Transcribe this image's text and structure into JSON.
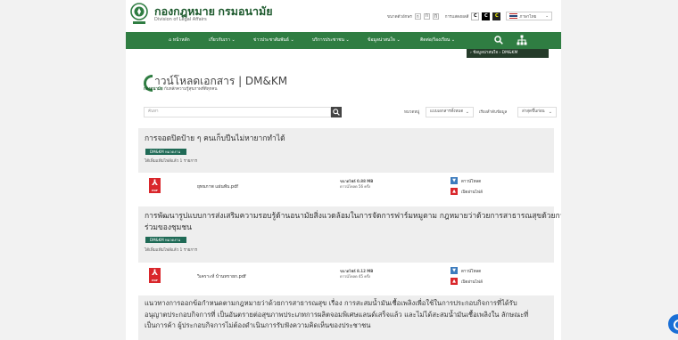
{
  "header": {
    "title": "กองกฎหมาย กรมอนามัย",
    "subtitle": "Division of Legal Affairs",
    "font_label": "ขนาดตัวอักษร",
    "font_sizes": [
      "ก",
      "ก",
      "ก"
    ],
    "contrast_label": "การแสดงผลสี",
    "contrast_opts": [
      "C",
      "C",
      "C"
    ],
    "language": "ภาษาไทย"
  },
  "nav": {
    "home": "หน้าหลัก",
    "about": "เกี่ยวกับเรา",
    "news": "ข่าวประชาสัมพันธ์",
    "services": "บริการประชาชน",
    "info": "ข้อมูลน่าสนใจ",
    "contact": "ติดต่อ/ร้องเรียน"
  },
  "breadcrumb": {
    "text": "›  ข้อมูลน่าสนใจ   ›  DM&KM"
  },
  "page": {
    "title": "าวน์โหลดเอกสาร | DM&KM",
    "sub_bold": "กองอนามัย",
    "sub_rest": "กับหลักความรู้สุขภาพที่ดีทุกคน"
  },
  "search": {
    "placeholder": "ค้นหา",
    "category_label": "หมวดหมู่",
    "category_value": "แบบเอกสารทั้งหมด",
    "sort_label": "เรียงลำดับข้อมูล",
    "sort_value": "ล่าสุดขึ้นก่อน"
  },
  "colors": {
    "green": "#2f7d42",
    "tag": "#1f6a56",
    "pdf": "#d9262b"
  },
  "cards": [
    {
      "title_lines": [
        "การจอดปิดป้าย ๆ คนเก็บปีนไม่หายากทำได้"
      ],
      "tag": "DM&KM หมวดงาน",
      "count": "ได้เพิ่มแฟ้มไฟล์แล้ว 1 รายการ",
      "file": {
        "name": "ยุทธภาพ แผ่นพับ.pdf",
        "size": "ขนาดไฟล์ 0.88 MB",
        "downloads": "ดาวน์โหลด 56 ครั้ง",
        "download_label": "ดาวน์โหลด",
        "preview_label": "เปิดอ่านไฟล์"
      }
    },
    {
      "title_lines": [
        "การพัฒนารูปแบบการส่งเสริมความรอบรู้ด้านอนามัยสิ่งแวดล้อมในการจัดการฟาร์มหมูตาม กฎหมายว่าด้วยการสาธารณสุขด้วยการมีส่วน",
        "ร่วมของชุมชน"
      ],
      "tag": "DM&KM หมวดงาน",
      "count": "ได้เพิ่มแฟ้มไฟล์แล้ว 1 รายการ",
      "file": {
        "name": "วิเคราะห์ บ้านทรายก.pdf",
        "size": "ขนาดไฟล์ 8.12 MB",
        "downloads": "ดาวน์โหลด 45 ครั้ง",
        "download_label": "ดาวน์โหลด",
        "preview_label": "เปิดอ่านไฟล์"
      }
    },
    {
      "title_lines": [
        "แนวทางการออกข้อกำหนดตามกฎหมายว่าด้วยการสาธารณสุข เรื่อง การสะสมน้ำมันเชื้อเพลิงเพื่อใช้ในการประกอบกิจการที่ได้รับ",
        "อนุญาตประกอบกิจการที่ เป็นอันตรายต่อสุขภาพประเภทการผลิตจอมพิเศษแลนด์เสร็จแล้ว และไม่ได้สะสมน้ำมันเชื้อเพลิงใน ลักษณะที่",
        "เป็นการค้า ผู้ประกอบกิจการไม่ต้องดำเนินการรับฟังความคิดเห็นของประชาชน"
      ]
    }
  ]
}
